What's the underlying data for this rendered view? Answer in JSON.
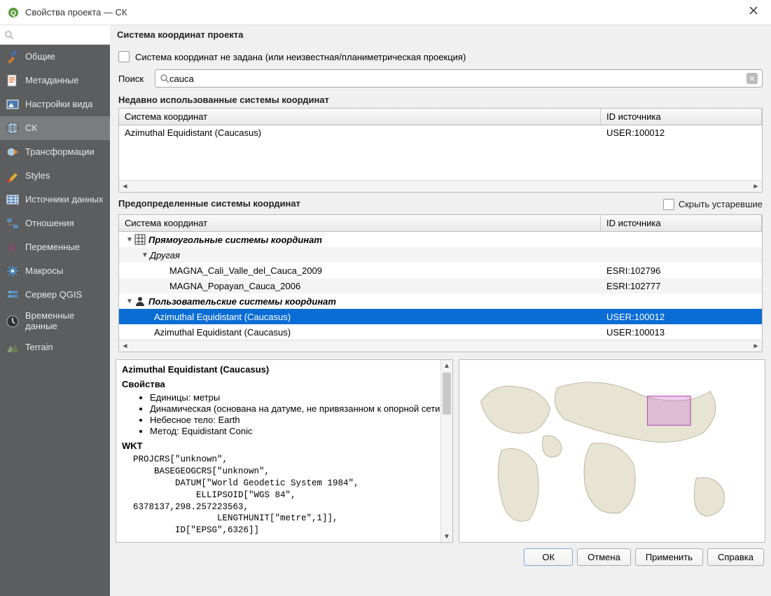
{
  "window": {
    "title": "Свойства проекта — СК"
  },
  "sidebar": {
    "items": [
      {
        "label": "Общие"
      },
      {
        "label": "Метаданные"
      },
      {
        "label": "Настройки вида"
      },
      {
        "label": "СК"
      },
      {
        "label": "Трансформации"
      },
      {
        "label": "Styles"
      },
      {
        "label": "Источники данных"
      },
      {
        "label": "Отношения"
      },
      {
        "label": "Переменные"
      },
      {
        "label": "Макросы"
      },
      {
        "label": "Сервер QGIS"
      },
      {
        "label": "Временные данные"
      },
      {
        "label": "Terrain"
      }
    ]
  },
  "main": {
    "heading": "Система координат проекта",
    "no_crs_label": "Система координат не задана (или неизвестная/планиметрическая проекция)",
    "search_label": "Поиск",
    "search_value": "cauca",
    "recent_heading": "Недавно использованные системы координат",
    "cols": {
      "name": "Система координат",
      "id": "ID источника"
    },
    "recent_rows": [
      {
        "name": "Azimuthal Equidistant (Caucasus)",
        "id": "USER:100012"
      }
    ],
    "predefined_heading": "Предопределенные системы координат",
    "hide_deprecated": "Скрыть устаревшие",
    "tree": {
      "group1": "Прямоугольные системы координат",
      "sub1": "Другая",
      "rows1": [
        {
          "name": "MAGNA_Cali_Valle_del_Cauca_2009",
          "id": "ESRI:102796"
        },
        {
          "name": "MAGNA_Popayan_Cauca_2006",
          "id": "ESRI:102777"
        }
      ],
      "group2": "Пользовательские системы координат",
      "rows2": [
        {
          "name": "Azimuthal Equidistant (Caucasus)",
          "id": "USER:100012"
        },
        {
          "name": "Azimuthal Equidistant (Caucasus)",
          "id": "USER:100013"
        }
      ]
    },
    "detail": {
      "crs_name": "Azimuthal Equidistant (Caucasus)",
      "props_h": "Свойства",
      "props": [
        "Единицы: метры",
        "Динамическая (основана на датуме, не привязанном к опорной сети)",
        "Небесное тело: Earth",
        "Метод: Equidistant Conic"
      ],
      "wkt_h": "WKT",
      "wkt": "PROJCRS[\"unknown\",\n    BASEGEOGCRS[\"unknown\",\n        DATUM[\"World Geodetic System 1984\",\n            ELLIPSOID[\"WGS 84\",\n6378137,298.257223563,\n                LENGTHUNIT[\"metre\",1]],\n        ID[\"EPSG\",6326]]"
    }
  },
  "buttons": {
    "ok": "ОК",
    "cancel": "Отмена",
    "apply": "Применить",
    "help": "Справка"
  }
}
